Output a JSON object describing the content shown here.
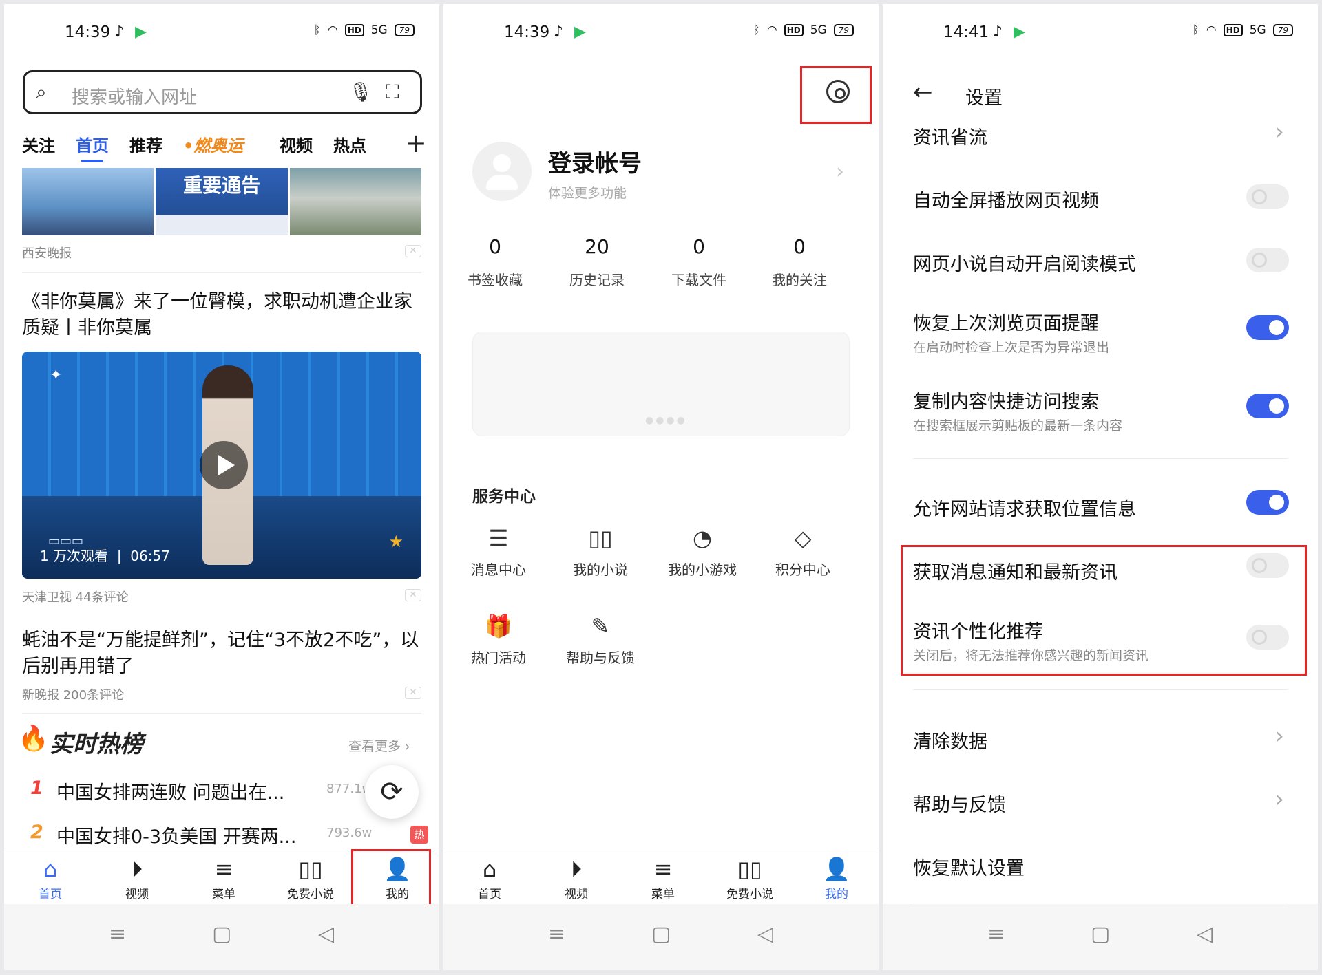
{
  "status": {
    "time1": "14:39",
    "time2": "14:39",
    "time3": "14:41",
    "signal": "5G",
    "battery": "79"
  },
  "panel1": {
    "search_placeholder": "搜索或输入网址",
    "tabs": [
      "关注",
      "首页",
      "推荐",
      "•燃奥运",
      "视频",
      "热点"
    ],
    "thumb_notice": "重要通告",
    "meta1": "西安晚报",
    "headline1": "《非你莫属》来了一位臀模，求职动机遭企业家质疑丨非你莫属",
    "video_views": "1 万次观看",
    "video_duration": "06:57",
    "meta2": "天津卫视   44条评论",
    "headline2": "蚝油不是“万能提鲜剂”，记住“3不放2不吃”，以后别再用错了",
    "meta3": "新晚报   200条评论",
    "hot_title": "实时热榜",
    "see_more": "查看更多",
    "hot_items": [
      {
        "rank": "1",
        "text": "中国女排两连败 问题出在...",
        "count": "877.1w"
      },
      {
        "rank": "2",
        "text": "中国女排0-3负美国 开赛两...",
        "count": "793.6w",
        "badge": "热"
      }
    ]
  },
  "bottom_nav": [
    "首页",
    "视频",
    "菜单",
    "免费小说",
    "我的"
  ],
  "panel2": {
    "login_title": "登录帐号",
    "login_sub": "体验更多功能",
    "stats": [
      {
        "num": "0",
        "label": "书签收藏"
      },
      {
        "num": "20",
        "label": "历史记录"
      },
      {
        "num": "0",
        "label": "下载文件"
      },
      {
        "num": "0",
        "label": "我的关注"
      }
    ],
    "service_title": "服务中心",
    "services": [
      "消息中心",
      "我的小说",
      "我的小游戏",
      "积分中心",
      "热门活动",
      "帮助与反馈"
    ]
  },
  "panel3": {
    "title": "设置",
    "rows": [
      {
        "title": "资讯省流"
      },
      {
        "title": "自动全屏播放网页视频",
        "toggle": false
      },
      {
        "title": "网页小说自动开启阅读模式",
        "toggle": false
      },
      {
        "title": "恢复上次浏览页面提醒",
        "sub": "在启动时检查上次是否为异常退出",
        "toggle": true
      },
      {
        "title": "复制内容快捷访问搜索",
        "sub": "在搜索框展示剪贴板的最新一条内容",
        "toggle": true
      },
      {
        "title": "允许网站请求获取位置信息",
        "toggle": true
      },
      {
        "title": "获取消息通知和最新资讯",
        "toggle": false
      },
      {
        "title": "资讯个性化推荐",
        "sub": "关闭后，将无法推荐你感兴趣的新闻资讯",
        "toggle": false
      },
      {
        "title": "清除数据"
      },
      {
        "title": "帮助与反馈"
      },
      {
        "title": "恢复默认设置"
      }
    ]
  },
  "colors": {
    "accent": "#3a5fea",
    "highlight": "#e02828"
  }
}
